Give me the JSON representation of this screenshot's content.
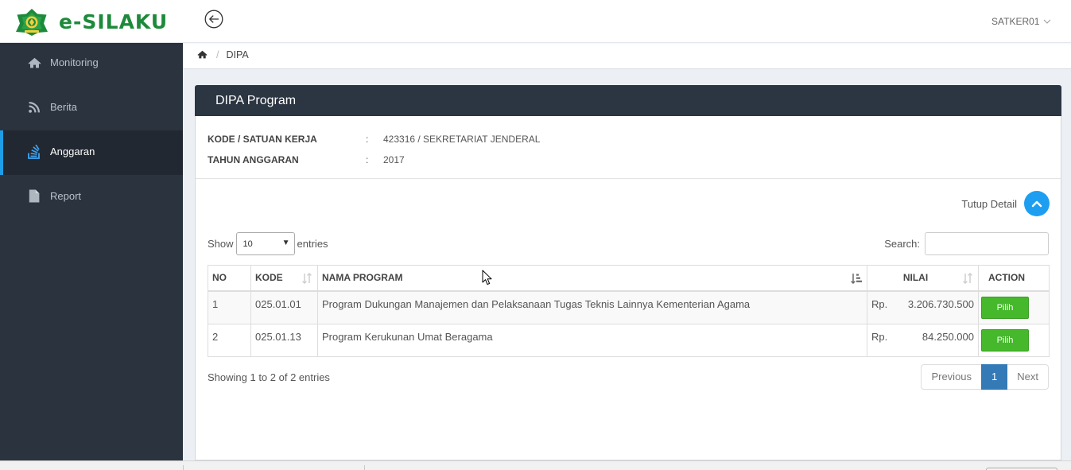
{
  "app": {
    "name": "e-SILAKU",
    "user": "SATKER01"
  },
  "sidebar": {
    "items": [
      {
        "label": "Monitoring",
        "icon": "home-icon",
        "active": false
      },
      {
        "label": "Berita",
        "icon": "rss-icon",
        "active": false
      },
      {
        "label": "Anggaran",
        "icon": "stack-icon",
        "active": true
      },
      {
        "label": "Report",
        "icon": "file-icon",
        "active": false
      }
    ]
  },
  "breadcrumb": {
    "home_icon": "home-icon",
    "separator": "/",
    "current": "DIPA"
  },
  "panel": {
    "title": "DIPA Program"
  },
  "info": [
    {
      "label": "KODE / SATUAN KERJA",
      "separator": ":",
      "value": "423316 / SEKRETARIAT JENDERAL"
    },
    {
      "label": "TAHUN ANGGARAN",
      "separator": ":",
      "value": "2017"
    }
  ],
  "detail_toggle": {
    "label": "Tutup Detail",
    "icon": "chevron-up-icon"
  },
  "table_controls": {
    "show_label": "Show",
    "page_length": "10",
    "entries_label": "entries",
    "search_label": "Search:",
    "search_value": ""
  },
  "table": {
    "columns": [
      {
        "label": "NO",
        "sortable": false
      },
      {
        "label": "KODE",
        "sortable": true,
        "sort": "none"
      },
      {
        "label": "NAMA PROGRAM",
        "sortable": true,
        "sort": "ascending"
      },
      {
        "label": "NILAI",
        "sortable": true,
        "sort": "none"
      },
      {
        "label": "ACTION",
        "sortable": false
      }
    ],
    "rows": [
      {
        "no": "1",
        "kode": "025.01.01",
        "nama_program": "Program Dukungan Manajemen dan Pelaksanaan Tugas Teknis Lainnya Kementerian Agama",
        "currency": "Rp.",
        "nilai": "3.206.730.500",
        "action": "Pilih"
      },
      {
        "no": "2",
        "kode": "025.01.13",
        "nama_program": "Program Kerukunan Umat Beragama",
        "currency": "Rp.",
        "nilai": "84.250.000",
        "action": "Pilih"
      }
    ]
  },
  "table_footer": {
    "info": "Showing 1 to 2 of 2 entries",
    "pagination": {
      "previous": "Previous",
      "pages": [
        "1"
      ],
      "current_page": "1",
      "next": "Next"
    }
  },
  "colors": {
    "brand_green": "#1d8a3b",
    "sidebar_bg": "#2b333e",
    "sidebar_active_bg": "#222831",
    "sidebar_active_accent": "#1f9de6",
    "panel_header_bg": "#2c3542",
    "toggle_button": "#1e9ef0",
    "pilih_button": "#45b82b",
    "page_active": "#337ab7"
  }
}
